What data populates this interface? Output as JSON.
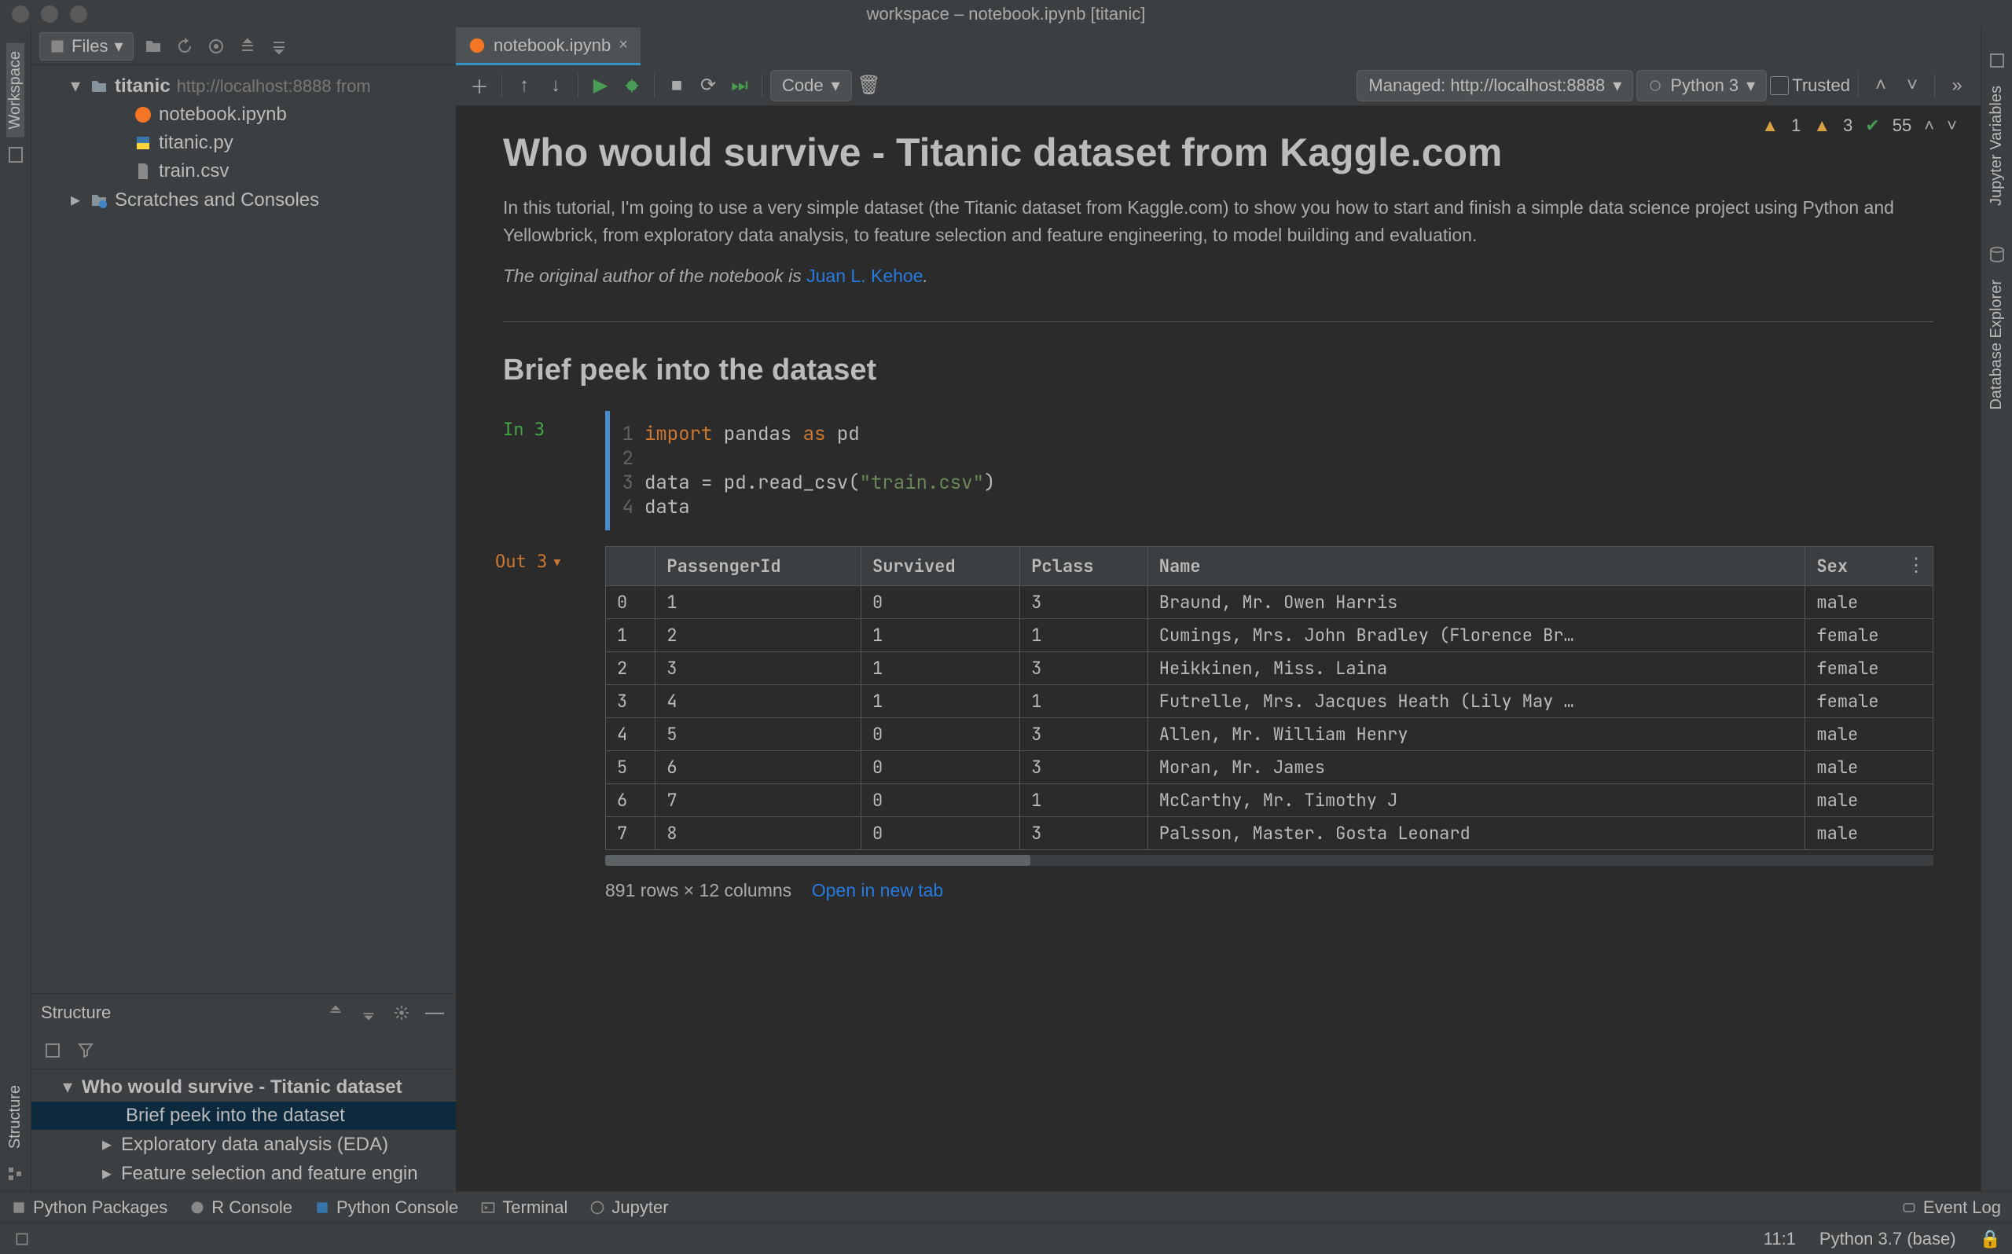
{
  "window": {
    "title": "workspace – notebook.ipynb [titanic]"
  },
  "left_gutter": {
    "workspace": "Workspace",
    "structure": "Structure"
  },
  "right_gutter": {
    "jupyter_vars": "Jupyter Variables",
    "db_explorer": "Database Explorer"
  },
  "project": {
    "files_label": "Files",
    "root": {
      "name": "titanic",
      "hint": "http://localhost:8888 from"
    },
    "children": [
      {
        "name": "notebook.ipynb",
        "type": "notebook"
      },
      {
        "name": "titanic.py",
        "type": "python"
      },
      {
        "name": "train.csv",
        "type": "csv"
      }
    ],
    "scratches": "Scratches and Consoles"
  },
  "structure": {
    "title": "Structure",
    "root": "Who would survive - Titanic dataset",
    "items": [
      {
        "label": "Brief peek into the dataset",
        "selected": true
      },
      {
        "label": "Exploratory data analysis (EDA)",
        "expandable": true
      },
      {
        "label": "Feature selection and feature engin",
        "expandable": true
      }
    ]
  },
  "tab": {
    "name": "notebook.ipynb"
  },
  "toolbar": {
    "cell_type": "Code",
    "server": "Managed: http://localhost:8888",
    "kernel": "Python 3",
    "trusted": "Trusted"
  },
  "badges": {
    "warn1": "1",
    "warn2": "3",
    "ok": "55"
  },
  "markdown": {
    "title": "Who would survive - Titanic dataset from Kaggle.com",
    "para1": "In this tutorial, I'm going to use a very simple dataset (the Titanic dataset from Kaggle.com) to show you how to start and finish a simple data science project using Python and Yellowbrick, from exploratory data analysis, to feature selection and feature engineering, to model building and evaluation.",
    "para2_prefix": "The original author of the notebook is ",
    "para2_link": "Juan L. Kehoe",
    "para2_suffix": ".",
    "h2": "Brief peek into the dataset"
  },
  "code": {
    "in_label": "In 3",
    "lines": [
      {
        "n": "1",
        "tokens": [
          [
            "kw",
            "import"
          ],
          [
            "",
            " pandas "
          ],
          [
            "kw",
            "as"
          ],
          [
            "",
            " pd"
          ]
        ]
      },
      {
        "n": "2",
        "tokens": [
          [
            "",
            ""
          ]
        ]
      },
      {
        "n": "3",
        "tokens": [
          [
            "",
            "data = pd.read_csv("
          ],
          [
            "str",
            "\"train.csv\""
          ],
          [
            "",
            ")"
          ]
        ]
      },
      {
        "n": "4",
        "tokens": [
          [
            "",
            "data"
          ]
        ]
      }
    ]
  },
  "output": {
    "out_label": "Out 3",
    "columns": [
      "",
      "PassengerId",
      "Survived",
      "Pclass",
      "Name",
      "Sex"
    ],
    "rows": [
      [
        "0",
        "1",
        "0",
        "3",
        "Braund, Mr. Owen Harris",
        "male"
      ],
      [
        "1",
        "2",
        "1",
        "1",
        "Cumings, Mrs. John Bradley (Florence Br…",
        "female"
      ],
      [
        "2",
        "3",
        "1",
        "3",
        "Heikkinen, Miss. Laina",
        "female"
      ],
      [
        "3",
        "4",
        "1",
        "1",
        "Futrelle, Mrs. Jacques Heath (Lily May …",
        "female"
      ],
      [
        "4",
        "5",
        "0",
        "3",
        "Allen, Mr. William Henry",
        "male"
      ],
      [
        "5",
        "6",
        "0",
        "3",
        "Moran, Mr. James",
        "male"
      ],
      [
        "6",
        "7",
        "0",
        "1",
        "McCarthy, Mr. Timothy J",
        "male"
      ],
      [
        "7",
        "8",
        "0",
        "3",
        "Palsson, Master. Gosta Leonard",
        "male"
      ]
    ],
    "summary": "891 rows × 12 columns",
    "open_new": "Open in new tab"
  },
  "bottom": {
    "python_packages": "Python Packages",
    "r_console": "R Console",
    "python_console": "Python Console",
    "terminal": "Terminal",
    "jupyter": "Jupyter",
    "event_log": "Event Log"
  },
  "status": {
    "cursor": "11:1",
    "interpreter": "Python 3.7 (base)"
  }
}
